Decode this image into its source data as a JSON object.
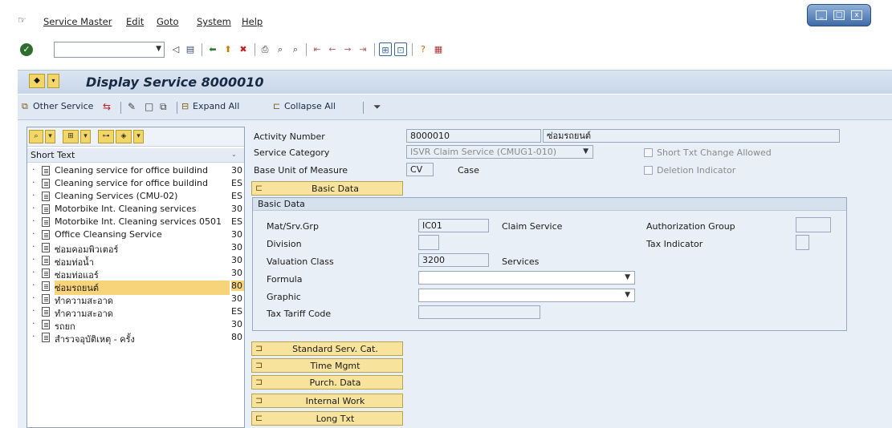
{
  "menu": {
    "items": [
      "Service Master",
      "Edit",
      "Goto",
      "System",
      "Help"
    ]
  },
  "window": {
    "min": "_",
    "max": "□",
    "close": "x"
  },
  "toolbar": {
    "command_value": "",
    "icons": [
      "back-icon",
      "save-icon",
      "back-nav-icon",
      "exit-icon",
      "cancel-icon",
      "print-icon",
      "find-icon",
      "find-next-icon",
      "first-page-icon",
      "prev-page-icon",
      "next-page-icon",
      "last-page-icon",
      "new-session-icon",
      "shortcut-icon",
      "help-icon",
      "layout-icon"
    ]
  },
  "title": "Display Service 8000010",
  "app_toolbar": {
    "other_service": "Other Service",
    "expand_all": "Expand All",
    "collapse_all": "Collapse All"
  },
  "tree": {
    "header": "Short Text",
    "rows": [
      {
        "text": "Cleaning service for office buildind",
        "code": "30"
      },
      {
        "text": "Cleaning service for office buildind",
        "code": "ES"
      },
      {
        "text": "Cleaning Services (CMU-02)",
        "code": "ES"
      },
      {
        "text": "Motorbike Int. Cleaning services",
        "code": "30"
      },
      {
        "text": "Motorbike Int. Cleaning services 0501",
        "code": "ES"
      },
      {
        "text": "Office Cleansing Service",
        "code": "30"
      },
      {
        "text": "ซ่อมคอมพิวเตอร์",
        "code": "30"
      },
      {
        "text": "ซ่อมท่อน้ำ",
        "code": "30"
      },
      {
        "text": "ซ่อมท่อแอร์",
        "code": "30"
      },
      {
        "text": "ซ่อมรถยนต์",
        "code": "80"
      },
      {
        "text": "ทำความสะอาด",
        "code": "30"
      },
      {
        "text": "ทำความสะอาด",
        "code": "ES"
      },
      {
        "text": "รถยก",
        "code": "30"
      },
      {
        "text": "สำรวจอุบัติเหตุ - ครั้ง",
        "code": "80"
      }
    ]
  },
  "header_fields": {
    "activity_number_label": "Activity Number",
    "activity_number": "8000010",
    "activity_text": "ซ่อมรถยนต์",
    "service_category_label": "Service Category",
    "service_category": "ISVR Claim Service (CMUG1-010)",
    "short_txt_change_label": "Short Txt Change Allowed",
    "base_uom_label": "Base Unit of Measure",
    "base_uom": "CV",
    "base_uom_text": "Case",
    "deletion_indicator_label": "Deletion Indicator"
  },
  "basic_data_button": "Basic Data",
  "basic_data": {
    "title": "Basic Data",
    "mat_srv_grp_label": "Mat/Srv.Grp",
    "mat_srv_grp": "IC01",
    "mat_srv_grp_text": "Claim Service",
    "authorization_group_label": "Authorization Group",
    "authorization_group": "",
    "division_label": "Division",
    "division": "",
    "tax_indicator_label": "Tax Indicator",
    "tax_indicator": "",
    "valuation_class_label": "Valuation Class",
    "valuation_class": "3200",
    "valuation_class_text": "Services",
    "formula_label": "Formula",
    "formula": "",
    "graphic_label": "Graphic",
    "graphic": "",
    "tax_tariff_label": "Tax Tariff Code",
    "tax_tariff": ""
  },
  "nav_buttons": [
    "Standard Serv. Cat.",
    "Time Mgmt",
    "Purch. Data",
    "Internal Work",
    "Long Txt"
  ]
}
